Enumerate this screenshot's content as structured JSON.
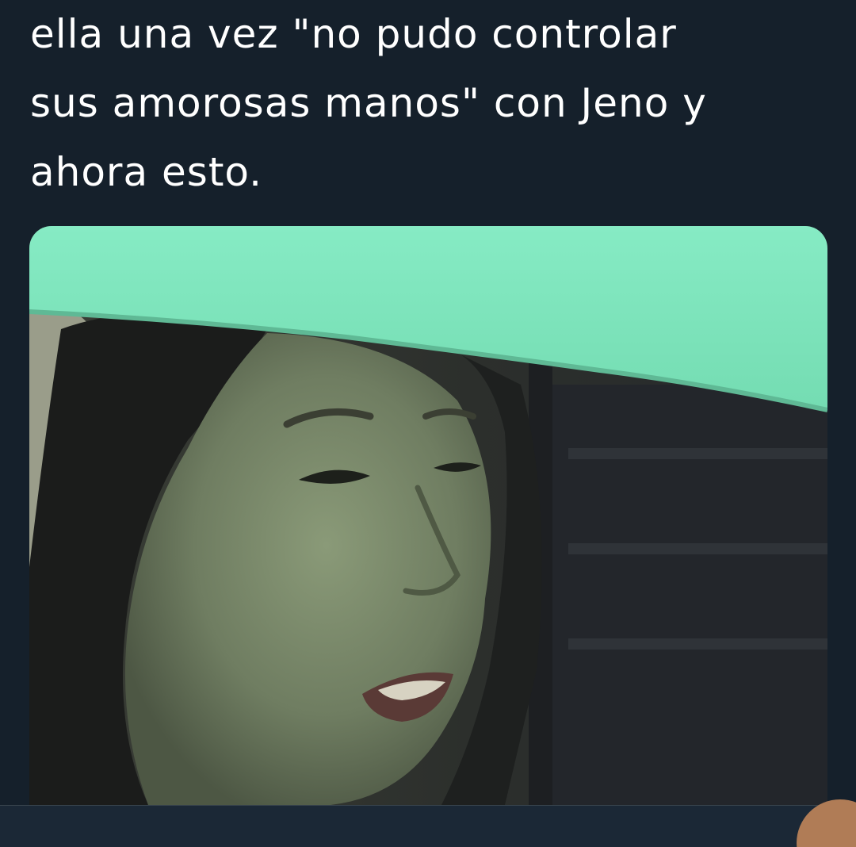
{
  "tweet": {
    "text_lines": [
      "ella una vez \"no pudo controlar",
      "sus amorosas manos\" con Jeno y",
      "ahora esto."
    ]
  },
  "media": {
    "kind": "photo",
    "subject": "person-under-umbrella"
  },
  "colors": {
    "background": "#15202b",
    "text": "#ffffff",
    "umbrella": "#7ee6bd",
    "bottom_bar": "#1b2836"
  }
}
